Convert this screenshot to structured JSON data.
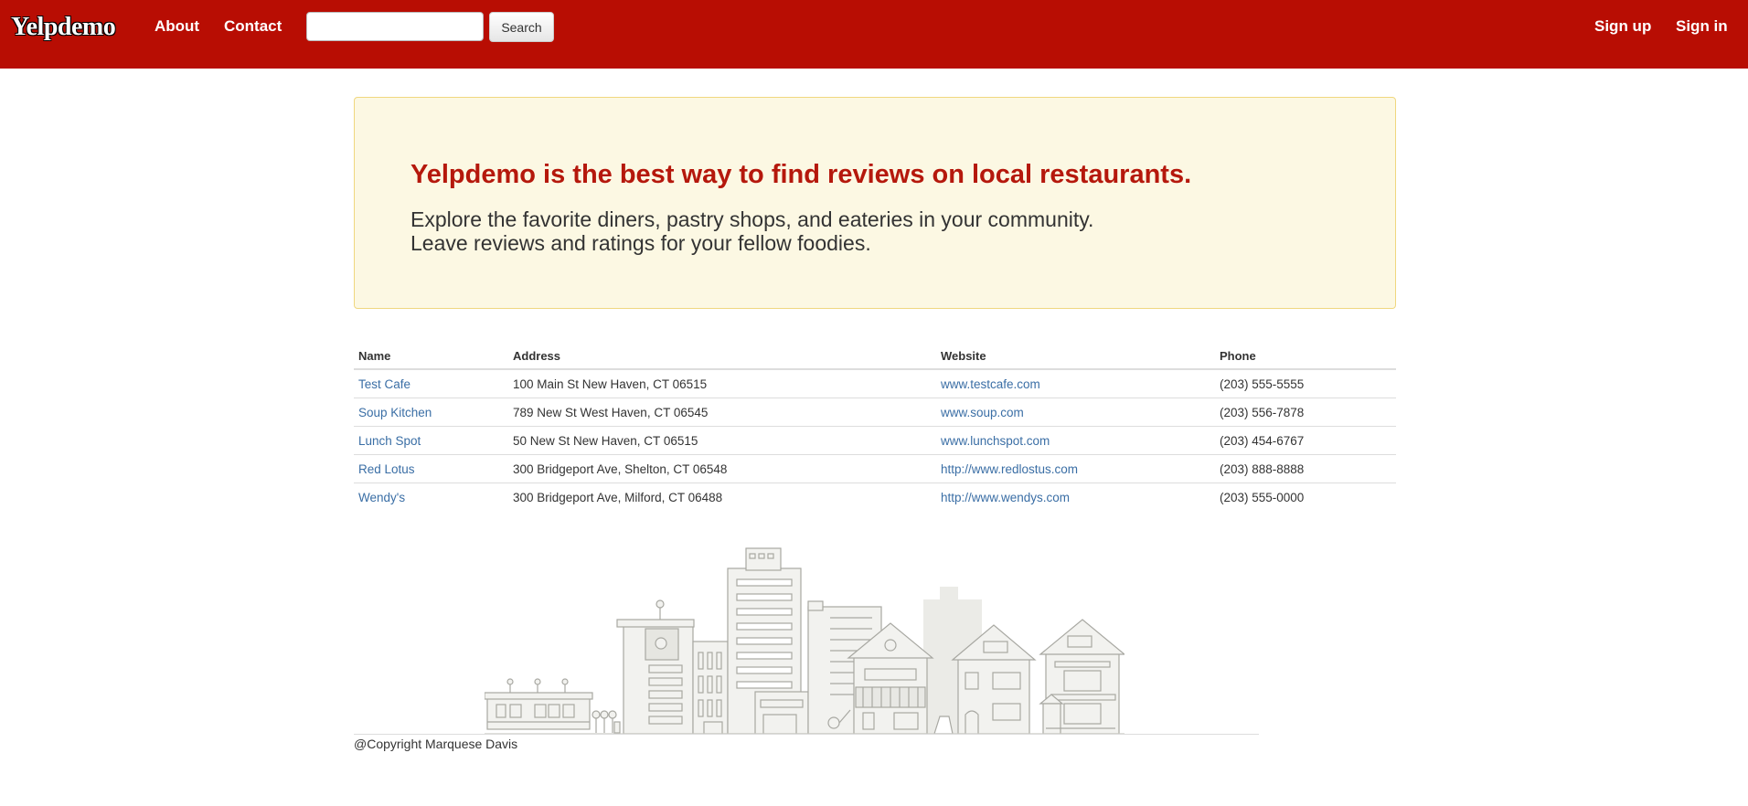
{
  "navbar": {
    "brand": "Yelpdemo",
    "links": [
      "About",
      "Contact"
    ],
    "search": {
      "value": "",
      "placeholder": "",
      "button_label": "Search"
    },
    "right_links": [
      "Sign up",
      "Sign in"
    ],
    "bg_color": "#b80d03"
  },
  "jumbotron": {
    "title": "Yelpdemo is the best way to find reviews on local restaurants.",
    "line1": "Explore the favorite diners, pastry shops, and eateries in your community.",
    "line2": "Leave reviews and ratings for your fellow foodies."
  },
  "table": {
    "headers": [
      "Name",
      "Address",
      "Website",
      "Phone"
    ],
    "rows": [
      {
        "name": "Test Cafe",
        "address": "100 Main St New Haven, CT 06515",
        "website": "www.testcafe.com",
        "phone": "(203) 555-5555"
      },
      {
        "name": "Soup Kitchen",
        "address": "789 New St West Haven, CT 06545",
        "website": "www.soup.com",
        "phone": "(203) 556-7878"
      },
      {
        "name": "Lunch Spot",
        "address": "50 New St New Haven, CT 06515",
        "website": "www.lunchspot.com",
        "phone": "(203) 454-6767"
      },
      {
        "name": "Red Lotus",
        "address": "300 Bridgeport Ave, Shelton, CT 06548",
        "website": "http://www.redlostus.com",
        "phone": "(203) 888-8888"
      },
      {
        "name": "Wendy's",
        "address": "300 Bridgeport Ave, Milford, CT 06488",
        "website": "http://www.wendys.com",
        "phone": "(203) 555-0000"
      }
    ]
  },
  "footer": {
    "copyright": "@Copyright Marquese Davis"
  }
}
